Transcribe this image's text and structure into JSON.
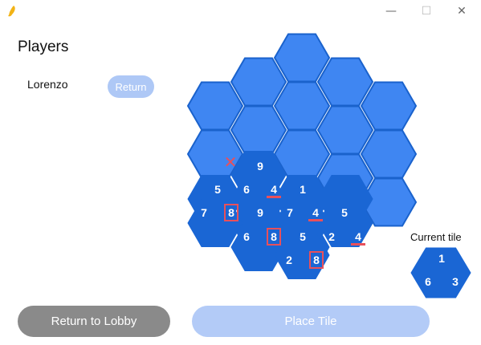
{
  "window": {
    "minimize": "—",
    "maximize": "☐",
    "close": "✕"
  },
  "players": {
    "title": "Players",
    "list": [
      {
        "name": "Lorenzo",
        "action": "Return"
      }
    ]
  },
  "board": {
    "colors": {
      "empty_fill": "#3f86f2",
      "placed_fill": "#1a66d4",
      "stroke": "#1a62cc",
      "marker": "#e8505b"
    },
    "placed_tiles": [
      {
        "row": 2,
        "col": 1,
        "top": "9",
        "left": "5",
        "right": "4"
      },
      {
        "row": 3,
        "col": 0,
        "top": "6",
        "left": "7",
        "right": "9"
      },
      {
        "row": 3,
        "col": 1,
        "top": "1",
        "left": "7",
        "right": "4"
      },
      {
        "row": 3,
        "col": 2,
        "top": "5",
        "left": "2",
        "right": "4"
      },
      {
        "row": 4,
        "col": 0,
        "top": "8",
        "left": "6",
        "right": "5"
      },
      {
        "row": 4,
        "col": 1,
        "top": "8",
        "left": "2",
        "right": "8"
      }
    ],
    "underlined": [
      "4",
      "4",
      "4"
    ],
    "boxed": [
      "8",
      "8",
      "8"
    ],
    "invalid_marker": "✕"
  },
  "current_tile": {
    "label": "Current tile",
    "top": "1",
    "left": "6",
    "right": "3"
  },
  "buttons": {
    "lobby": "Return to Lobby",
    "place": "Place Tile"
  }
}
